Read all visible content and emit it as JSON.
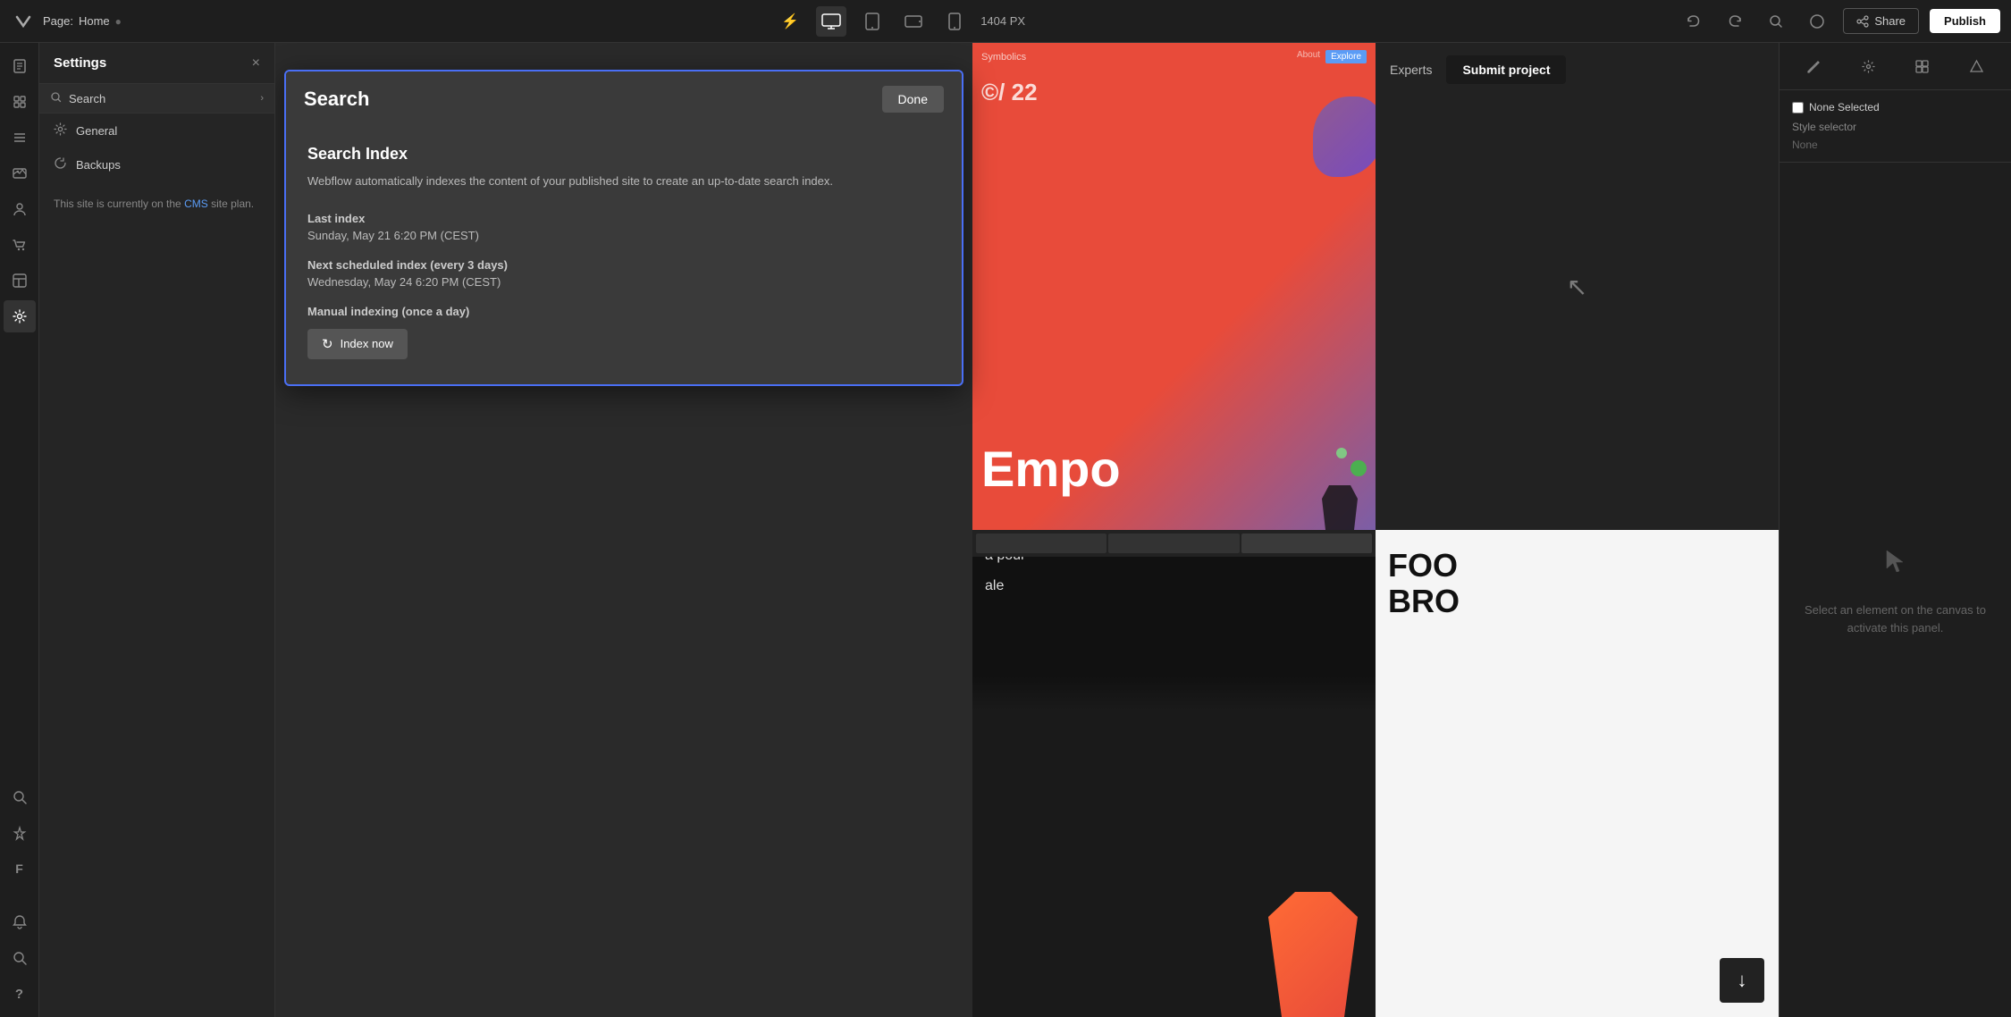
{
  "topbar": {
    "logo": "W",
    "page_label": "Page:",
    "page_name": "Home",
    "device_desktop_label": "Desktop",
    "device_tablet_label": "Tablet",
    "device_mobile_landscape_label": "Mobile Landscape",
    "device_mobile_label": "Mobile",
    "px_label": "1404 PX",
    "undo_icon": "↩",
    "redo_icon": "↪",
    "search_icon": "🔍",
    "account_icon": "👤",
    "share_label": "Share",
    "publish_label": "Publish"
  },
  "icon_sidebar": {
    "items": [
      {
        "name": "pages-icon",
        "icon": "⊞",
        "active": false
      },
      {
        "name": "components-icon",
        "icon": "◫",
        "active": false
      },
      {
        "name": "cms-icon",
        "icon": "≡",
        "active": false
      },
      {
        "name": "assets-icon",
        "icon": "□",
        "active": false
      },
      {
        "name": "users-icon",
        "icon": "👤",
        "active": false
      },
      {
        "name": "ecommerce-icon",
        "icon": "🛒",
        "active": false
      },
      {
        "name": "templates-icon",
        "icon": "⌧",
        "active": false
      },
      {
        "name": "settings-icon",
        "icon": "⚙",
        "active": true
      },
      {
        "name": "seo-icon",
        "icon": "◎",
        "active": false
      },
      {
        "name": "integrations-icon",
        "icon": "✦",
        "active": false
      },
      {
        "name": "forms-icon",
        "icon": "F",
        "active": false
      }
    ],
    "bottom_items": [
      {
        "name": "notifications-icon",
        "icon": "🔔"
      },
      {
        "name": "search-global-icon",
        "icon": "🔍"
      },
      {
        "name": "help-icon",
        "icon": "?"
      }
    ]
  },
  "settings_panel": {
    "title": "Settings",
    "close_label": "×",
    "search": {
      "label": "Search",
      "chevron": "›"
    },
    "nav_items": [
      {
        "name": "general",
        "icon": "⚙",
        "label": "General"
      },
      {
        "name": "backups",
        "icon": "↺",
        "label": "Backups"
      }
    ],
    "cms_note": "This site is currently on the",
    "cms_link": "CMS",
    "cms_note2": "site plan."
  },
  "search_modal": {
    "title": "Search",
    "done_label": "Done",
    "search_index": {
      "title": "Search Index",
      "description": "Webflow automatically indexes the content of your published site to create an up-to-date search index.",
      "last_index_label": "Last index",
      "last_index_value": "Sunday, May 21 6:20 PM (CEST)",
      "next_index_label": "Next scheduled index (every 3 days)",
      "next_index_value": "Wednesday, May 24 6:20 PM (CEST)",
      "manual_label": "Manual indexing (once a day)",
      "index_now_label": "Index now",
      "index_now_icon": "↻"
    }
  },
  "right_panel": {
    "toolbar_icons": [
      "✏️",
      "⚙",
      "⊞",
      "↗"
    ],
    "style_selector_label": "Style selector",
    "none_selected_label": "None Selected",
    "none_option": "None",
    "canvas_hint": "Select an element on the canvas\nto activate this panel."
  },
  "experts_bar": {
    "experts_label": "Experts",
    "submit_label": "Submit project"
  },
  "canvas": {
    "preview_tiles": [
      {
        "text": "Empo",
        "bg": "orange-gradient"
      },
      {
        "text": "",
        "bg": "dark"
      },
      {
        "text": "a pour",
        "sub": "ale",
        "bg": "black"
      },
      {
        "text": "FOO\nBRO",
        "bg": "light"
      }
    ]
  }
}
